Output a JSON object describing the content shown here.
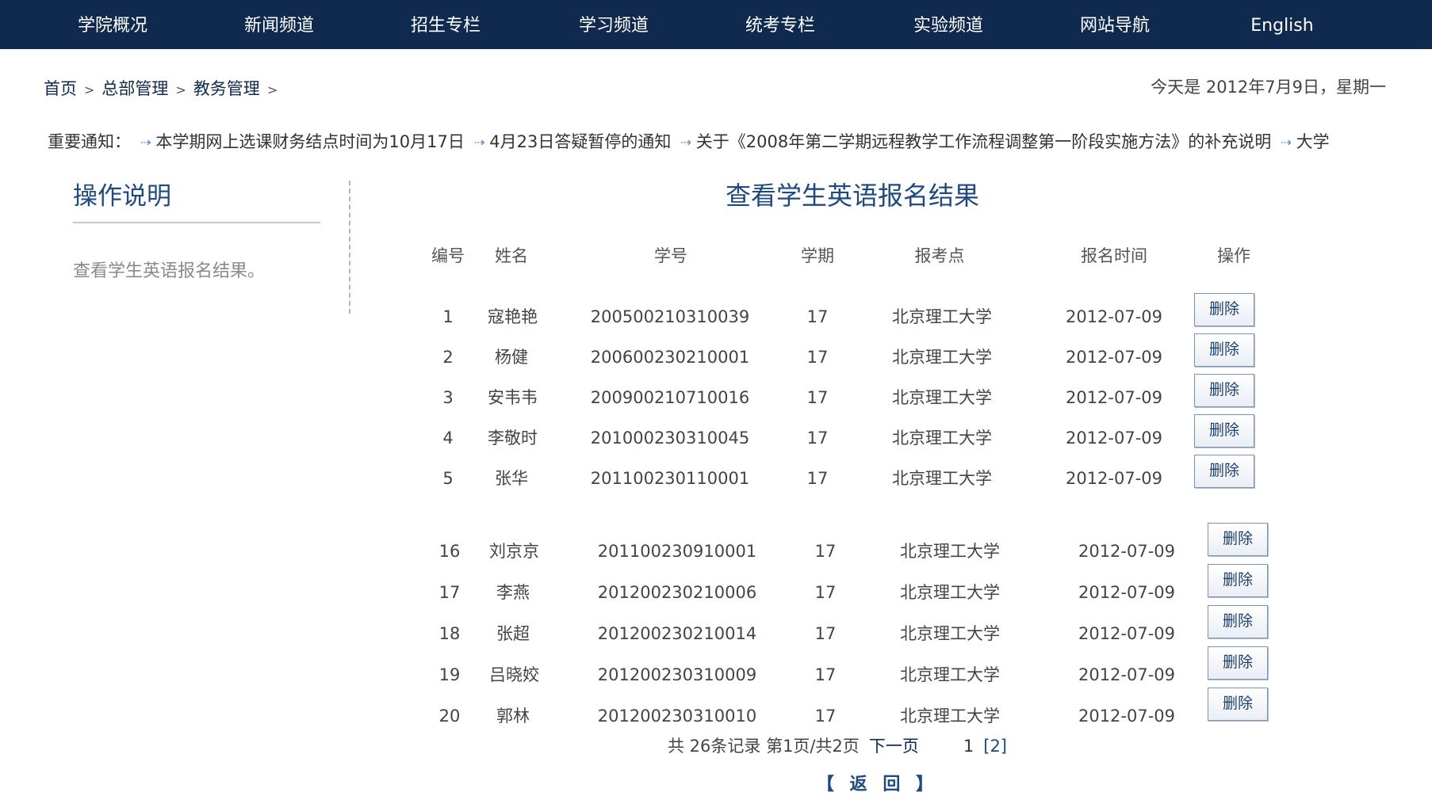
{
  "nav": {
    "items": [
      "学院概况",
      "新闻频道",
      "招生专栏",
      "学习频道",
      "统考专栏",
      "实验频道",
      "网站导航",
      "English"
    ]
  },
  "breadcrumb": {
    "items": [
      "首页",
      "总部管理",
      "教务管理"
    ],
    "separator": ">"
  },
  "today": "今天是  2012年7月9日，星期一",
  "notice": {
    "label": "重要通知：",
    "items": [
      "本学期网上选课财务结点时间为10月17日",
      "4月23日答疑暂停的通知",
      "关于《2008年第二学期远程教学工作流程调整第一阶段实施方法》的补充说明",
      "大学"
    ]
  },
  "sidebar": {
    "title": "操作说明",
    "text": "查看学生英语报名结果。"
  },
  "main": {
    "title": "查看学生英语报名结果",
    "columns": [
      "编号",
      "姓名",
      "学号",
      "学期",
      "报考点",
      "报名时间",
      "操作"
    ],
    "delete_label": "删除",
    "rows_group1": [
      [
        "1",
        "寇艳艳",
        "200500210310039",
        "17",
        "北京理工大学",
        "2012-07-09"
      ],
      [
        "2",
        "杨健",
        "200600230210001",
        "17",
        "北京理工大学",
        "2012-07-09"
      ],
      [
        "3",
        "安韦韦",
        "200900210710016",
        "17",
        "北京理工大学",
        "2012-07-09"
      ],
      [
        "4",
        "李敬时",
        "201000230310045",
        "17",
        "北京理工大学",
        "2012-07-09"
      ],
      [
        "5",
        "张华",
        "201100230110001",
        "17",
        "北京理工大学",
        "2012-07-09"
      ]
    ],
    "rows_group2": [
      [
        "16",
        "刘京京",
        "201100230910001",
        "17",
        "北京理工大学",
        "2012-07-09"
      ],
      [
        "17",
        "李燕",
        "201200230210006",
        "17",
        "北京理工大学",
        "2012-07-09"
      ],
      [
        "18",
        "张超",
        "201200230210014",
        "17",
        "北京理工大学",
        "2012-07-09"
      ],
      [
        "19",
        "吕晓姣",
        "201200230310009",
        "17",
        "北京理工大学",
        "2012-07-09"
      ],
      [
        "20",
        "郭林",
        "201200230310010",
        "17",
        "北京理工大学",
        "2012-07-09"
      ]
    ]
  },
  "pager": {
    "summary": "共 26条记录 第1页/共2页",
    "next": "下一页",
    "page1": "1",
    "page2": "[2]"
  },
  "back": "【 返 回 】",
  "colors": {
    "nav_bg": "#0f2a4e",
    "title": "#1f4a7f"
  }
}
